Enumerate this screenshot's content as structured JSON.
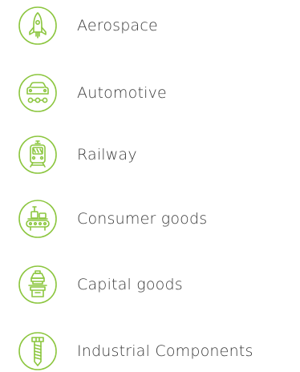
{
  "accent_color": "#8cc63f",
  "text_color": "#3a3a3a",
  "industries": [
    {
      "label": "Aerospace",
      "icon": "rocket-icon"
    },
    {
      "label": "Automotive",
      "icon": "car-icon"
    },
    {
      "label": "Railway",
      "icon": "train-icon"
    },
    {
      "label": "Consumer goods",
      "icon": "conveyor-icon"
    },
    {
      "label": "Capital goods",
      "icon": "press-machine-icon"
    },
    {
      "label": "Industrial Components",
      "icon": "bolt-icon"
    }
  ]
}
